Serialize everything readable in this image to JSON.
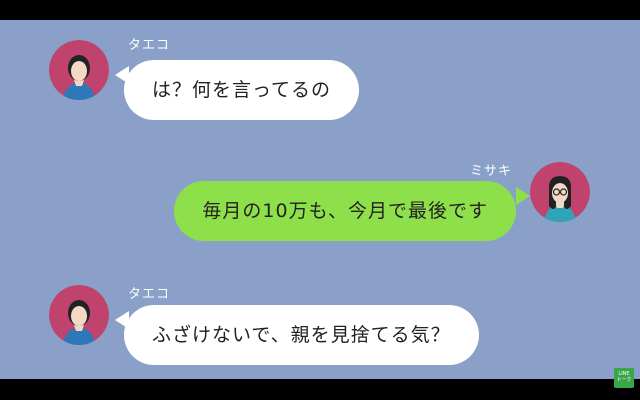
{
  "messages": [
    {
      "sender": "タエコ",
      "side": "left",
      "text": "は？何を言ってるの"
    },
    {
      "sender": "ミサキ",
      "side": "right",
      "text": "毎月の10万も、今月で最後です"
    },
    {
      "sender": "タエコ",
      "side": "left",
      "text": "ふざけないで、親を見捨てる気？"
    }
  ],
  "logo": {
    "line1": "LINE",
    "line2": "トーク"
  },
  "colors": {
    "background": "#8ba0c9",
    "bubble_left": "#ffffff",
    "bubble_right": "#8ee04a",
    "avatar_bg": "#c0436e"
  }
}
